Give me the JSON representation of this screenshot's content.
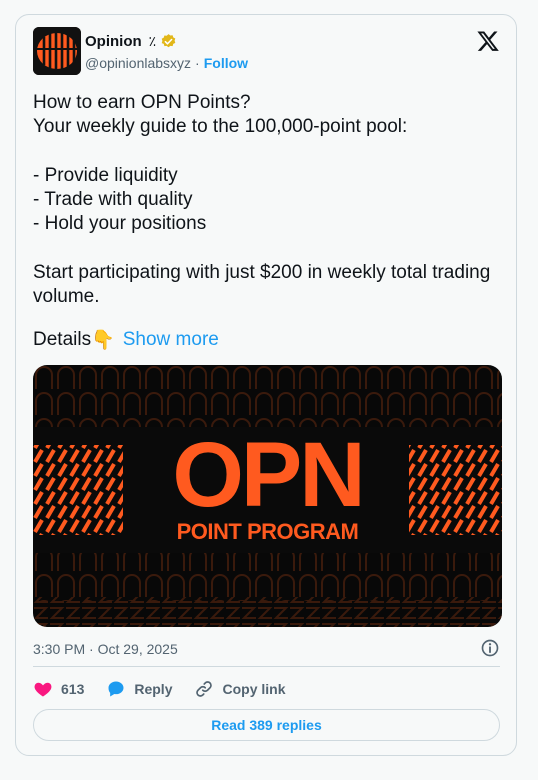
{
  "author": {
    "name": "Opinion",
    "name_suffix": "٪",
    "handle": "@opinionlabsxyz",
    "separator": "·",
    "follow_label": "Follow"
  },
  "tweet": {
    "text": "How to earn OPN Points?\nYour weekly guide to the 100,000-point pool:\n\n- Provide liquidity\n- Trade with quality\n- Hold your positions\n\nStart participating with just $200 in weekly total trading volume.",
    "details_label": "Details",
    "details_emoji": "👇",
    "show_more_label": "Show more"
  },
  "media": {
    "title": "OPN",
    "subtitle": "POINT PROGRAM",
    "accent_color": "#ff5a1f"
  },
  "timestamp": "3:30 PM · Oct 29, 2025",
  "actions": {
    "like_count": "613",
    "reply_label": "Reply",
    "copy_link_label": "Copy link"
  },
  "read_replies_label": "Read 389 replies",
  "colors": {
    "link": "#1d9bf0",
    "like": "#f91880",
    "verified": "#e2b719"
  }
}
